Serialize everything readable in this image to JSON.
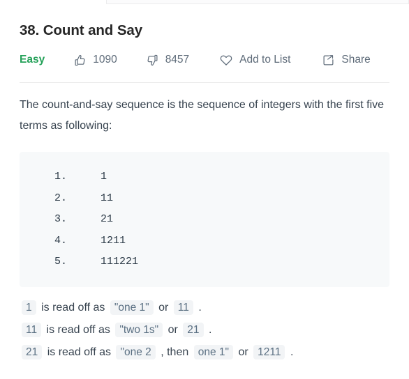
{
  "problem": {
    "title": "38. Count and Say",
    "difficulty": "Easy",
    "difficulty_color": "#25a159",
    "likes": "1090",
    "dislikes": "8457",
    "add_to_list_label": "Add to List",
    "share_label": "Share",
    "icons": {
      "likes": "thumbs-up-icon",
      "dislikes": "thumbs-down-icon",
      "add_to_list": "heart-icon",
      "share": "share-icon"
    }
  },
  "description": {
    "paragraph": "The count-and-say sequence is the sequence of integers with the first five terms as following:"
  },
  "code_block": {
    "background": "#f7f9fa",
    "rows": [
      {
        "index": "1.",
        "value": "1"
      },
      {
        "index": "2.",
        "value": "11"
      },
      {
        "index": "3.",
        "value": "21"
      },
      {
        "index": "4.",
        "value": "1211"
      },
      {
        "index": "5.",
        "value": "111221"
      }
    ]
  },
  "explanations": [
    {
      "parts": [
        {
          "type": "code",
          "text": "1"
        },
        {
          "type": "text",
          "text": "is read off as"
        },
        {
          "type": "code",
          "text": "\"one 1\""
        },
        {
          "type": "text",
          "text": "or"
        },
        {
          "type": "code",
          "text": "11"
        },
        {
          "type": "text",
          "text": "."
        }
      ]
    },
    {
      "parts": [
        {
          "type": "code",
          "text": "11"
        },
        {
          "type": "text",
          "text": "is read off as"
        },
        {
          "type": "code",
          "text": "\"two 1s\""
        },
        {
          "type": "text",
          "text": "or"
        },
        {
          "type": "code",
          "text": "21"
        },
        {
          "type": "text",
          "text": "."
        }
      ]
    },
    {
      "parts": [
        {
          "type": "code",
          "text": "21"
        },
        {
          "type": "text",
          "text": "is read off as"
        },
        {
          "type": "code",
          "text": "\"one 2"
        },
        {
          "type": "text",
          "text": ", then"
        },
        {
          "type": "code",
          "text": "one 1\""
        },
        {
          "type": "text",
          "text": "or"
        },
        {
          "type": "code",
          "text": "1211"
        },
        {
          "type": "text",
          "text": "."
        }
      ]
    }
  ]
}
